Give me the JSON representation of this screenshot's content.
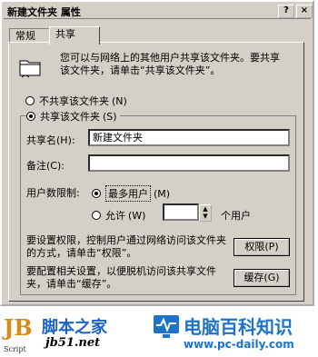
{
  "window": {
    "title": "新建文件夹 属性",
    "help_btn": "?",
    "close_btn": "×"
  },
  "tabs": [
    {
      "label": "常规"
    },
    {
      "label": "共享"
    }
  ],
  "share": {
    "description": "您可以与网络上的其他用户共享该文件夹。要共享该文件夹，请单击“共享该文件夹”。",
    "not_shared_label": "不共享该文件夹",
    "not_shared_key": "(N)",
    "shared_label": "共享该文件夹",
    "shared_key": "(S)",
    "share_name_label": "共享名(H):",
    "share_name_value": "新建文件夹",
    "comment_label": "备注(C):",
    "comment_value": "",
    "user_limit_label": "用户数限制:",
    "max_allowed_label": "最多用户",
    "max_allowed_key": "(M)",
    "allow_label": "允许",
    "allow_key": "(W)",
    "allow_value": "",
    "users_suffix": "个用户",
    "permissions_desc": "要设置权限，控制用户通过网络访问该文件夹的方式，请单击“权限”。",
    "permissions_btn": "权限(P)",
    "cache_desc": "要配置相关设置，以便脱机访问该共享文件夹，请单击“缓存”。",
    "cache_btn": "缓存(G)"
  },
  "watermark": {
    "left_logo_text": "JB",
    "left_logo_sub": "Script",
    "left_site_name": "脚本之家",
    "left_site_url": "jb51.net",
    "right_site_name": "电脑百科知识",
    "right_site_url": "www.pc-daily.com"
  }
}
